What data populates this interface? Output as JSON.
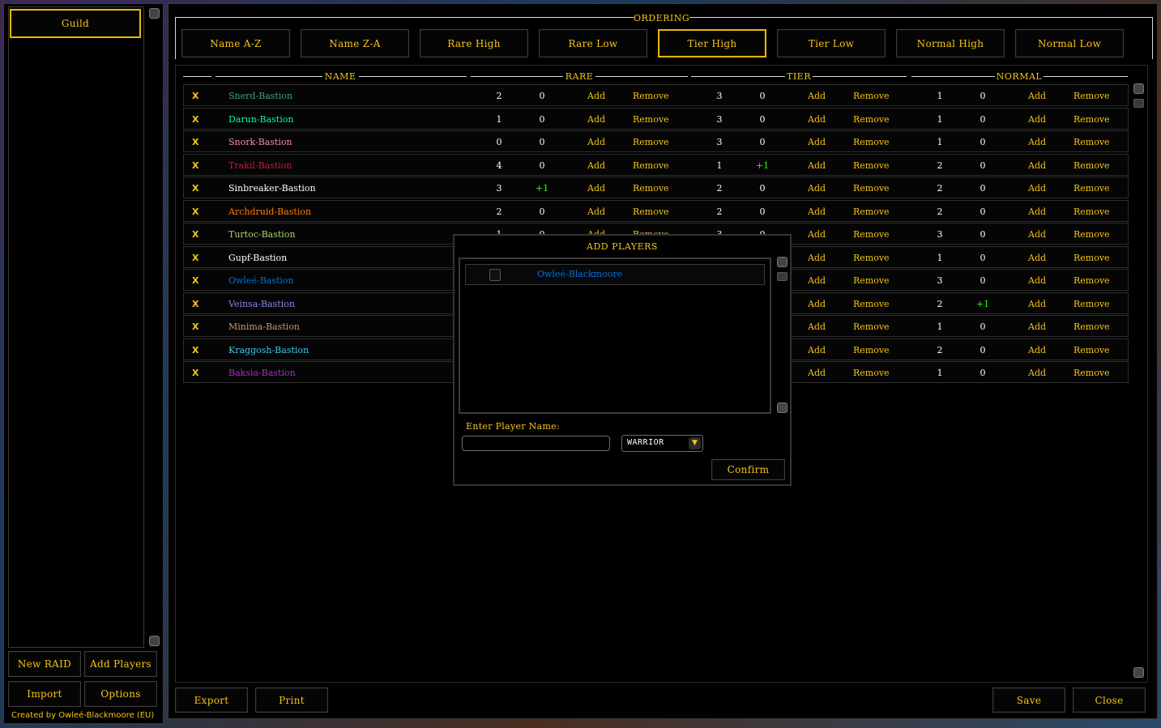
{
  "sidebar": {
    "guild_label": "Guild",
    "new_raid_label": "New RAID",
    "add_players_label": "Add Players",
    "import_label": "Import",
    "options_label": "Options",
    "credit": "Created by Owleé-Blackmoore (EU)"
  },
  "ordering": {
    "title": "ORDERING",
    "buttons": [
      "Name A-Z",
      "Name Z-A",
      "Rare High",
      "Rare Low",
      "Tier High",
      "Tier Low",
      "Normal High",
      "Normal Low"
    ],
    "active": "Tier High"
  },
  "columns": {
    "name": "NAME",
    "rare": "RARE",
    "tier": "TIER",
    "normal": "NORMAL"
  },
  "actions": {
    "remove_mark": "X",
    "add": "Add",
    "remove": "Remove"
  },
  "colors": {
    "gold": "#f5c518",
    "hunter": "#aad372",
    "monk": "#00ff98",
    "paladin": "#f48cba",
    "deathknight": "#c41e3a",
    "priest": "#ffffff",
    "druid": "#ff7c0a",
    "shaman": "#0070dd",
    "warlock": "#8788ee",
    "warrior": "#c69b6d",
    "mage": "#3fc7eb",
    "demonhunter": "#a330c9",
    "bonus": "#1eff00"
  },
  "players": [
    {
      "name": "Snerd-Bastion",
      "color": "#40a080",
      "rare": "2",
      "rare_b": "0",
      "tier": "3",
      "tier_b": "0",
      "normal": "1",
      "normal_b": "0"
    },
    {
      "name": "Darun-Bastion",
      "color": "#00ff98",
      "rare": "1",
      "rare_b": "0",
      "tier": "3",
      "tier_b": "0",
      "normal": "1",
      "normal_b": "0"
    },
    {
      "name": "Snork-Bastion",
      "color": "#f48cba",
      "rare": "0",
      "rare_b": "0",
      "tier": "3",
      "tier_b": "0",
      "normal": "1",
      "normal_b": "0"
    },
    {
      "name": "Trakil-Bastion",
      "color": "#c41e3a",
      "rare": "4",
      "rare_b": "0",
      "tier": "1",
      "tier_b": "+1",
      "normal": "2",
      "normal_b": "0"
    },
    {
      "name": "Sinbreaker-Bastion",
      "color": "#ffffff",
      "rare": "3",
      "rare_b": "+1",
      "tier": "2",
      "tier_b": "0",
      "normal": "2",
      "normal_b": "0"
    },
    {
      "name": "Archdruid-Bastion",
      "color": "#ff7c0a",
      "rare": "2",
      "rare_b": "0",
      "tier": "2",
      "tier_b": "0",
      "normal": "2",
      "normal_b": "0"
    },
    {
      "name": "Turtoc-Bastion",
      "color": "#aad372",
      "rare": "1",
      "rare_b": "0",
      "tier": "3",
      "tier_b": "0",
      "normal": "3",
      "normal_b": "0"
    },
    {
      "name": "Gupf-Bastion",
      "color": "#ffffff",
      "rare": "",
      "rare_b": "",
      "tier": "",
      "tier_b": "",
      "normal": "1",
      "normal_b": "0"
    },
    {
      "name": "Owleé-Bastion",
      "color": "#0070dd",
      "rare": "",
      "rare_b": "",
      "tier": "",
      "tier_b": "",
      "normal": "3",
      "normal_b": "0"
    },
    {
      "name": "Veinsa-Bastion",
      "color": "#8788ee",
      "rare": "",
      "rare_b": "",
      "tier": "",
      "tier_b": "",
      "normal": "2",
      "normal_b": "+1"
    },
    {
      "name": "Minima-Bastion",
      "color": "#c69b6d",
      "rare": "",
      "rare_b": "",
      "tier": "",
      "tier_b": "",
      "normal": "1",
      "normal_b": "0"
    },
    {
      "name": "Kraggosh-Bastion",
      "color": "#3fc7eb",
      "rare": "",
      "rare_b": "",
      "tier": "",
      "tier_b": "",
      "normal": "2",
      "normal_b": "0"
    },
    {
      "name": "Baksia-Bastion",
      "color": "#a330c9",
      "rare": "",
      "rare_b": "",
      "tier": "",
      "tier_b": "",
      "normal": "1",
      "normal_b": "0"
    }
  ],
  "modal": {
    "title": "ADD PLAYERS",
    "list": [
      {
        "name": "Owleé-Blackmoore",
        "color": "#0070dd",
        "checked": false
      }
    ],
    "enter_label": "Enter Player Name:",
    "name_value": "",
    "class_value": "WARRIOR",
    "confirm_label": "Confirm"
  },
  "footer": {
    "export_label": "Export",
    "print_label": "Print",
    "save_label": "Save",
    "close_label": "Close"
  }
}
